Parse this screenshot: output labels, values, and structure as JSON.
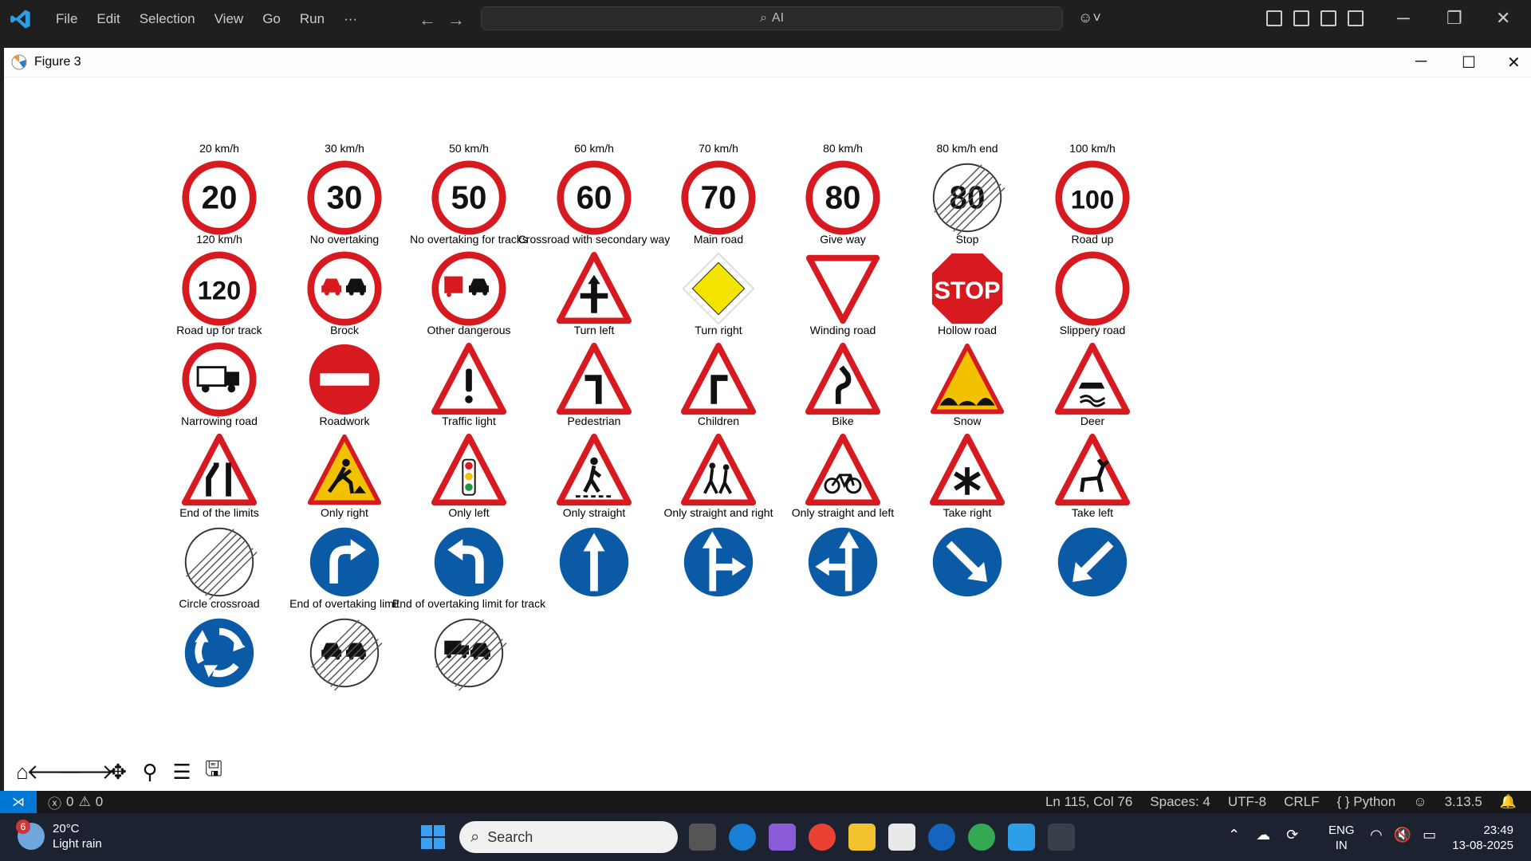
{
  "menubar": {
    "items": [
      "File",
      "Edit",
      "Selection",
      "View",
      "Go",
      "Run",
      "···"
    ],
    "search_text": "AI"
  },
  "figure": {
    "title": "Figure 3"
  },
  "signs": [
    {
      "label": "20 km/h",
      "kind": "speed",
      "text": "20"
    },
    {
      "label": "30 km/h",
      "kind": "speed",
      "text": "30"
    },
    {
      "label": "50 km/h",
      "kind": "speed",
      "text": "50"
    },
    {
      "label": "60 km/h",
      "kind": "speed",
      "text": "60"
    },
    {
      "label": "70 km/h",
      "kind": "speed",
      "text": "70"
    },
    {
      "label": "80 km/h",
      "kind": "speed",
      "text": "80"
    },
    {
      "label": "80 km/h end",
      "kind": "speed-end",
      "text": "80"
    },
    {
      "label": "100 km/h",
      "kind": "speed",
      "text": "100"
    },
    {
      "label": "120 km/h",
      "kind": "speed",
      "text": "120"
    },
    {
      "label": "No overtaking",
      "kind": "no-overtaking"
    },
    {
      "label": "No overtaking for tracks",
      "kind": "no-overtaking-trucks"
    },
    {
      "label": "Crossroad with secondary way",
      "kind": "tri-crossroad"
    },
    {
      "label": "Main road",
      "kind": "main-road"
    },
    {
      "label": "Give way",
      "kind": "give-way"
    },
    {
      "label": "Stop",
      "kind": "stop",
      "text": "STOP"
    },
    {
      "label": "Road up",
      "kind": "road-up"
    },
    {
      "label": "Road up for track",
      "kind": "road-up-truck"
    },
    {
      "label": "Brock",
      "kind": "no-entry"
    },
    {
      "label": "Other dangerous",
      "kind": "tri-exclaim"
    },
    {
      "label": "Turn left",
      "kind": "tri-turn-left"
    },
    {
      "label": "Turn right",
      "kind": "tri-turn-right"
    },
    {
      "label": "Winding road",
      "kind": "tri-winding"
    },
    {
      "label": "Hollow road",
      "kind": "tri-hollow"
    },
    {
      "label": "Slippery road",
      "kind": "tri-slippery"
    },
    {
      "label": "Narrowing road",
      "kind": "tri-narrowing"
    },
    {
      "label": "Roadwork",
      "kind": "tri-roadwork"
    },
    {
      "label": "Traffic light",
      "kind": "tri-traffic-light"
    },
    {
      "label": "Pedestrian",
      "kind": "tri-pedestrian"
    },
    {
      "label": "Children",
      "kind": "tri-children"
    },
    {
      "label": "Bike",
      "kind": "tri-bike"
    },
    {
      "label": "Snow",
      "kind": "tri-snow"
    },
    {
      "label": "Deer",
      "kind": "tri-deer"
    },
    {
      "label": "End of the limits",
      "kind": "end-limits"
    },
    {
      "label": "Only right",
      "kind": "blue-right"
    },
    {
      "label": "Only left",
      "kind": "blue-left"
    },
    {
      "label": "Only straight",
      "kind": "blue-straight"
    },
    {
      "label": "Only straight and right",
      "kind": "blue-straight-right"
    },
    {
      "label": "Only straight and left",
      "kind": "blue-straight-left"
    },
    {
      "label": "Take right",
      "kind": "blue-keep-right"
    },
    {
      "label": "Take left",
      "kind": "blue-keep-left"
    },
    {
      "label": "Circle crossroad",
      "kind": "blue-roundabout"
    },
    {
      "label": "End of overtaking limit",
      "kind": "end-no-overtaking"
    },
    {
      "label": "End of overtaking limit for track",
      "kind": "end-no-overtaking-trucks"
    }
  ],
  "statusbar": {
    "errors": "0",
    "warnings": "0",
    "position": "Ln 115, Col 76",
    "spaces": "Spaces: 4",
    "encoding": "UTF-8",
    "eol": "CRLF",
    "language": "{ } Python",
    "version": "3.13.5"
  },
  "taskbar": {
    "weather_temp": "20°C",
    "weather_desc": "Light rain",
    "weather_badge": "6",
    "search_placeholder": "Search",
    "lang_line1": "ENG",
    "lang_line2": "IN",
    "time": "23:49",
    "date": "13-08-2025"
  },
  "colors": {
    "sign_red": "#d71920",
    "sign_blue": "#0b5aa6",
    "vscode_blue": "#0078d4"
  }
}
